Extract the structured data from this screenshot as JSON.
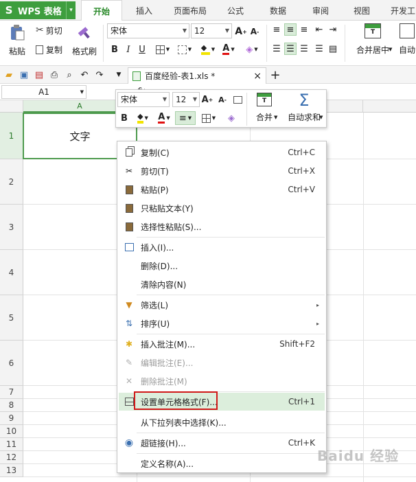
{
  "app": {
    "logo": "S",
    "name": "WPS 表格",
    "dropdown": "▾"
  },
  "tabs": [
    "开始",
    "插入",
    "页面布局",
    "公式",
    "数据",
    "审阅",
    "视图",
    "开发工"
  ],
  "ribbon": {
    "paste_label": "粘贴",
    "cut_label": "剪切",
    "copy_label": "复制",
    "format_painter_label": "格式刷",
    "font_name": "宋体",
    "font_size": "12",
    "merge_center_label": "合并居中",
    "auto_wrap_label": "自动"
  },
  "doc_tab": {
    "title": "百度经验-表1.xls *",
    "close": "×",
    "add": "+"
  },
  "formula_bar": {
    "cell_ref": "A1",
    "fx": "fx"
  },
  "sheet": {
    "column_a": "A",
    "rows": [
      "1",
      "2",
      "3",
      "4",
      "5",
      "6",
      "7",
      "8",
      "9",
      "10",
      "11",
      "12",
      "13"
    ],
    "a1_value": "文字"
  },
  "mini_toolbar": {
    "font_name": "宋体",
    "font_size": "12",
    "merge_label": "合并",
    "autosum_label": "自动求和"
  },
  "context_menu": {
    "items": [
      {
        "label": "复制(C)",
        "shortcut": "Ctrl+C"
      },
      {
        "label": "剪切(T)",
        "shortcut": "Ctrl+X"
      },
      {
        "label": "粘贴(P)",
        "shortcut": "Ctrl+V"
      },
      {
        "label": "只粘贴文本(Y)",
        "shortcut": ""
      },
      {
        "label": "选择性粘贴(S)...",
        "shortcut": ""
      },
      {
        "label": "插入(I)...",
        "shortcut": ""
      },
      {
        "label": "删除(D)...",
        "shortcut": ""
      },
      {
        "label": "清除内容(N)",
        "shortcut": ""
      },
      {
        "label": "筛选(L)",
        "shortcut": ""
      },
      {
        "label": "排序(U)",
        "shortcut": ""
      },
      {
        "label": "插入批注(M)...",
        "shortcut": "Shift+F2"
      },
      {
        "label": "编辑批注(E)...",
        "shortcut": ""
      },
      {
        "label": "删除批注(M)",
        "shortcut": ""
      },
      {
        "label": "设置单元格格式(F)...",
        "shortcut": "Ctrl+1"
      },
      {
        "label": "从下拉列表中选择(K)...",
        "shortcut": ""
      },
      {
        "label": "超链接(H)...",
        "shortcut": "Ctrl+K"
      },
      {
        "label": "定义名称(A)...",
        "shortcut": ""
      }
    ],
    "submenu_arrow": "▸"
  },
  "watermark": "Baidu 经验",
  "colors": {
    "brand_green": "#3e9e3e",
    "active_tab_text": "#2a8a2a",
    "selection_border": "#4d9a4d",
    "menu_hover": "#dceedc",
    "highlight_red": "#d01818"
  }
}
